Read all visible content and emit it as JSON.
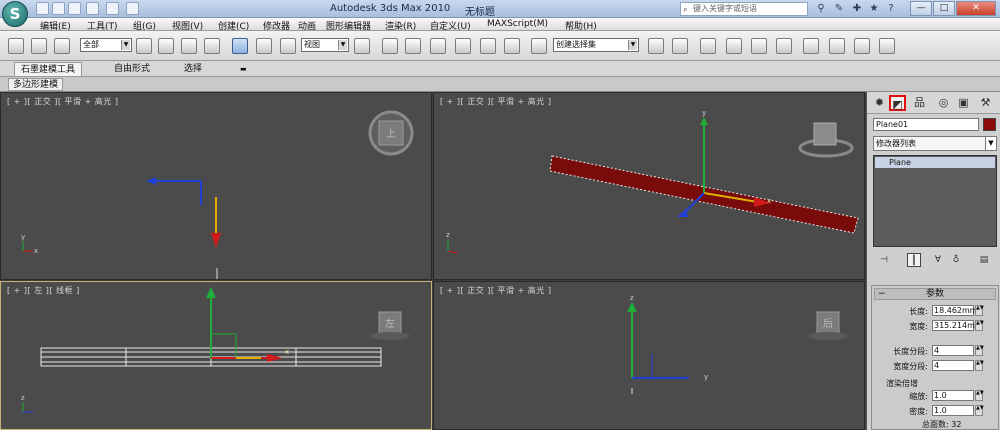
{
  "titlebar": {
    "app_title": "Autodesk 3ds Max  2010",
    "doc_title": "无标题",
    "search_placeholder": "键入关键字或短语",
    "min_label": "—",
    "max_label": "□",
    "close_label": "✕"
  },
  "menubar": {
    "items": [
      "编辑(E)",
      "工具(T)",
      "组(G)",
      "视图(V)",
      "创建(C)",
      "修改器",
      "动画",
      "图形编辑器",
      "渲染(R)",
      "自定义(U)",
      "MAXScript(M)",
      "帮助(H)"
    ]
  },
  "toolbar": {
    "selection_filter": "全部",
    "ref_coord": "视图",
    "named_selection": "创建选择集"
  },
  "ribbon": {
    "tabs": [
      "石墨建模工具",
      "自由形式",
      "选择"
    ],
    "sub_tab": "多边形建模"
  },
  "viewports": {
    "top_label": "[ + ][ 正交 ][ 平滑 + 高光 ]",
    "persp_label": "[ + ][ 正交 ][ 平滑 + 高光 ]",
    "left_label": "[ + ][ 左 ][ 线框 ]",
    "bottom_right_label": "[ + ][ 正交 ][ 平滑 + 高光 ]",
    "viewcube_top": "上",
    "viewcube_left": "左",
    "viewcube_right": "后",
    "axis_x": "x",
    "axis_y": "y",
    "axis_z": "z"
  },
  "command_panel": {
    "object_name": "Plane01",
    "object_color": "#8b0a0a",
    "modifier_list": "修改器列表",
    "stack_item": "Plane",
    "rollout_title": "参数",
    "length_label": "长度:",
    "length_value": "18.462mm",
    "width_label": "宽度:",
    "width_value": "315.214m",
    "length_segs_label": "长度分段:",
    "length_segs_value": "4",
    "width_segs_label": "宽度分段:",
    "width_segs_value": "4",
    "render_mult_label": "渲染倍增",
    "scale_label": "缩放:",
    "scale_value": "1.0",
    "density_label": "密度:",
    "density_value": "1.0",
    "total_faces_label": "总面数: 32"
  },
  "colors": {
    "plane_red": "#7a0b0b",
    "axis_red": "#d11b1b",
    "axis_green": "#1fae3a",
    "axis_blue": "#1f3fd6",
    "highlight_tab": "#e01010"
  }
}
